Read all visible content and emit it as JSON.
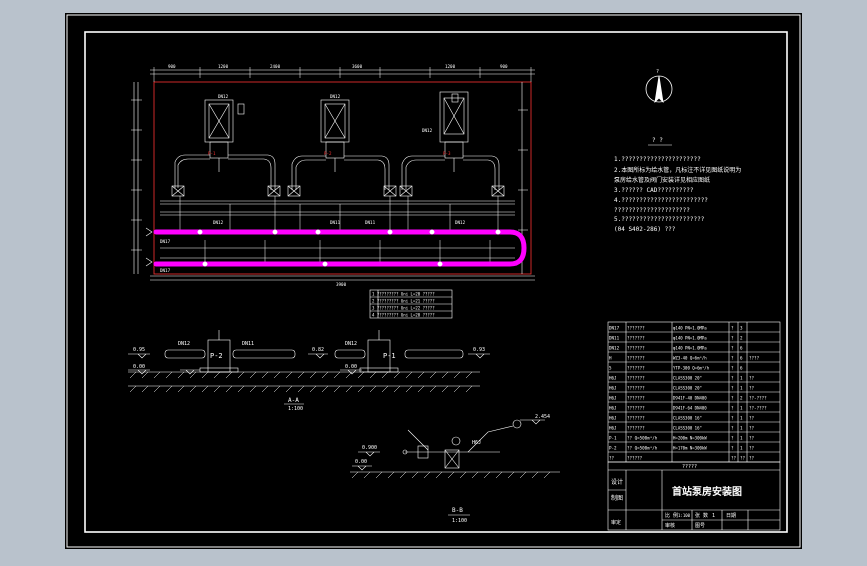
{
  "colors": {
    "background": "#b9c2cc",
    "sheet": "#000000",
    "line": "#ffffff",
    "pipe_highlight": "#ff00ff",
    "red_accent": "#ff3333"
  },
  "plan": {
    "top_dim_labels": [
      "900",
      "1200",
      "2400",
      "3600",
      "1200",
      "900"
    ],
    "total_width": "3900",
    "pumps": [
      "P-1",
      "P-2",
      "P-3"
    ],
    "pump_tags": [
      "DN12",
      "DN12",
      "DN12"
    ],
    "pipe_tags": [
      "DN12",
      "DN11",
      "DN12",
      "DN11"
    ],
    "bottom_left_label": "DN17",
    "bottom_right_label": "DN17"
  },
  "legend_rows": [
    "1  ?????????  Uni   L=20  ?????",
    "2  ?????????  Uni   L=21  ?????",
    "3  ?????????  Uni   L=22  ?????",
    "4  ?????????  Uni   L=20  ?????"
  ],
  "north": {
    "label": "?"
  },
  "notes": {
    "heading": "? ?",
    "lines": [
      "1.??????????????????????",
      "2.本图所标为给水管，凡标注不详见图纸说明为",
      "  泵房给水管及阀门安装详见相应图纸",
      "3.?????? CAD??????????",
      "4.????????????????????????",
      "  ?????????????????????",
      "5.???????????????????????",
      "  (04 S402-286)   ???"
    ]
  },
  "section_aa": {
    "levels_left": [
      "0.95",
      "0.00"
    ],
    "levels_mid": [
      "0.82",
      "0.00"
    ],
    "level_right": "0.93",
    "tags": [
      "DN12",
      "DN11",
      "DN12"
    ],
    "pumps": [
      "P-2",
      "P-1"
    ],
    "title": "A-A",
    "scale": "1:100"
  },
  "section_bb": {
    "level_a": "2.454",
    "level_b": "0.900",
    "level_c": "0.00",
    "tag": "H6J",
    "title": "B-B",
    "scale": "1:100"
  },
  "materials": {
    "rows": [
      [
        "DN17",
        "???????",
        "φ140 PN=1.0MPa",
        "?",
        "3",
        ""
      ],
      [
        "DN11",
        "???????",
        "φ140 PN=1.0MPa",
        "?",
        "2",
        ""
      ],
      [
        "DN12",
        "???????",
        "φ140 PN=1.0MPa",
        "?",
        "6",
        ""
      ],
      [
        "H",
        "???????",
        "WZ3-40  Q=6m³/h",
        "?",
        "6",
        "????"
      ],
      [
        "5",
        "???????",
        "YTP-300  Q=6m³/h",
        "?",
        "6",
        ""
      ],
      [
        "H6J",
        "???????",
        "CLASS300 20\"",
        "?",
        "1",
        "??"
      ],
      [
        "H6J",
        "???????",
        "CLASS300 20\"",
        "?",
        "1",
        "??"
      ],
      [
        "H6J",
        "???????",
        "D941F-40  DN400",
        "?",
        "2",
        "??-????"
      ],
      [
        "H6J",
        "???????",
        "D941F-64  DN400",
        "?",
        "1",
        "??-????"
      ],
      [
        "H6J",
        "???????",
        "CLASS300 16\"",
        "?",
        "1",
        "??"
      ],
      [
        "H6J",
        "???????",
        "CLASS300 16\"",
        "?",
        "1",
        "??"
      ],
      [
        "P-1",
        "?? Q=500m³/h",
        "H=200m N=300kW",
        "?",
        "1",
        "??"
      ],
      [
        "P-2",
        "?? Q=500m³/h",
        "H=170m N=300kW",
        "?",
        "1",
        "??"
      ],
      [
        "??",
        "??????",
        "",
        "??",
        "??",
        "??"
      ]
    ]
  },
  "title_block": {
    "header": "?????",
    "designer_label": "设计",
    "checker_label": "制图",
    "project_title": "首站泵房安装图",
    "scale_label": "比 例",
    "scale_value": "1:100",
    "sheet_label": "张 数",
    "sheet_value": "1",
    "date_label": "日期",
    "drawing_no_label": "图号",
    "review_label": "审核",
    "bottom_note": "审定"
  }
}
